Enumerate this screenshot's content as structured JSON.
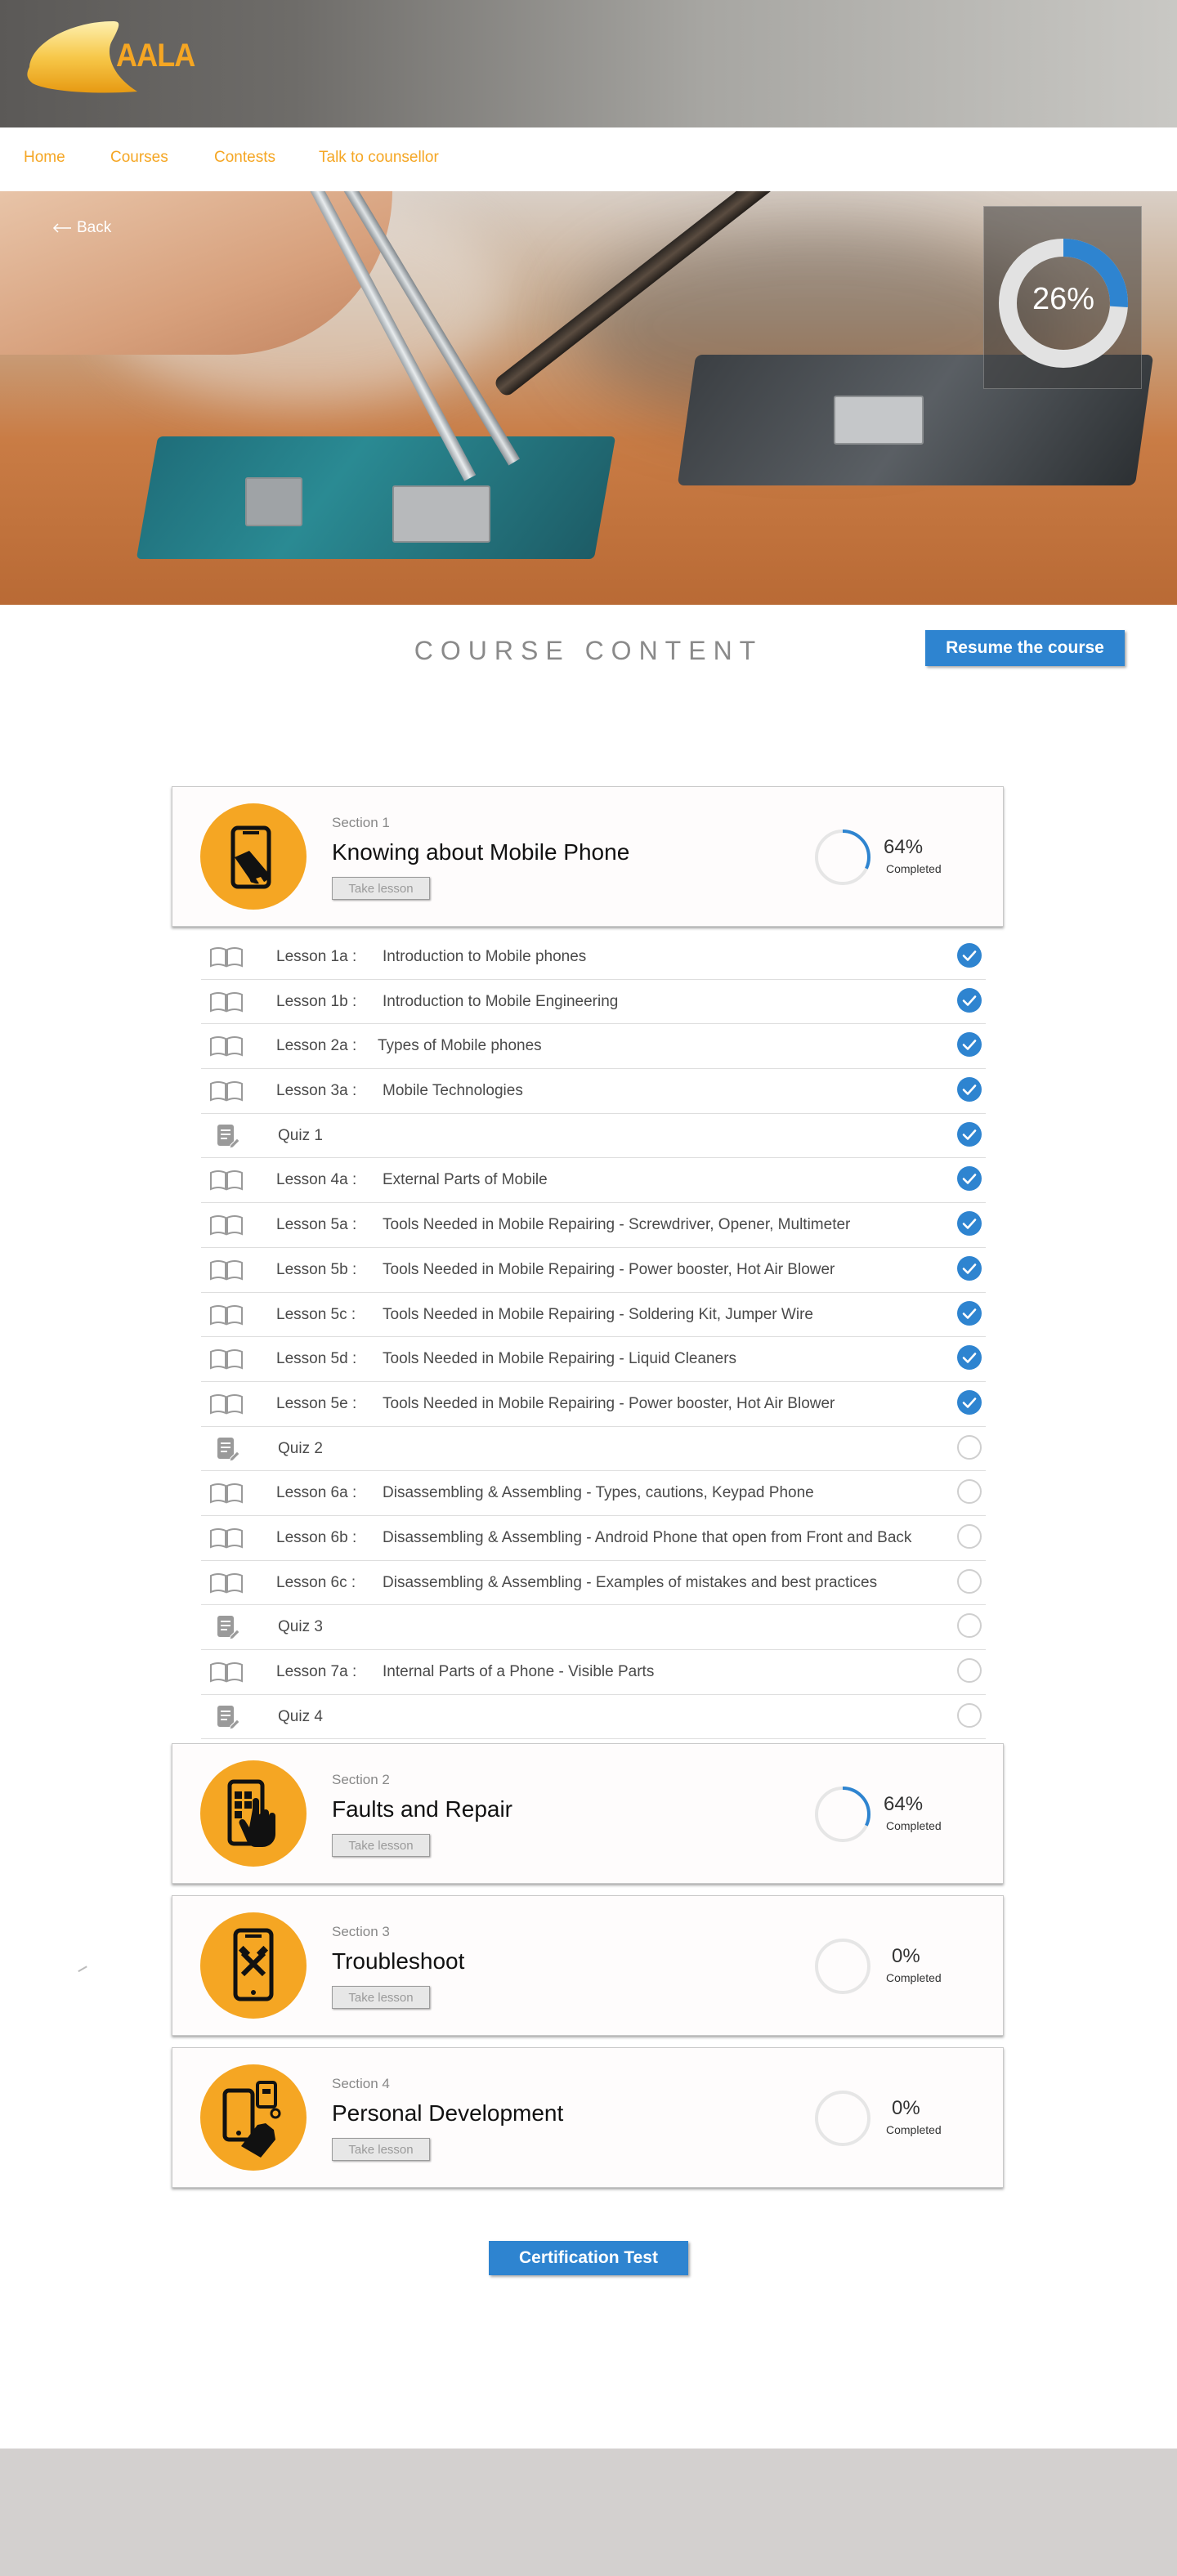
{
  "brand": {
    "name": "AALA",
    "accent": "#f5a623",
    "primary": "#2e84d0"
  },
  "nav": {
    "items": [
      {
        "label": "Home"
      },
      {
        "label": "Courses"
      },
      {
        "label": "Contests"
      },
      {
        "label": "Talk to counsellor"
      }
    ]
  },
  "hero": {
    "back_label": "Back",
    "course_progress": "26%",
    "course_progress_value": 0.26
  },
  "content": {
    "title": "COURSE CONTENT",
    "resume_label": "Resume the course",
    "certification_label": "Certification Test"
  },
  "sections": [
    {
      "kicker": "Section 1",
      "title": "Knowing about Mobile Phone",
      "button": "Take lesson",
      "progress": "64%",
      "progress_value": 0.64,
      "status": "Completed",
      "icon": "phone-wrench-icon"
    },
    {
      "kicker": "Section 2",
      "title": "Faults and Repair",
      "button": "Take lesson",
      "progress": "64%",
      "progress_value": 0.64,
      "status": "Completed",
      "icon": "phone-touch-icon"
    },
    {
      "kicker": "Section 3",
      "title": "Troubleshoot",
      "button": "Take lesson",
      "progress": "0%",
      "progress_value": 0,
      "status": "Completed",
      "icon": "phone-tools-icon"
    },
    {
      "kicker": "Section 4",
      "title": "Personal Development",
      "button": "Take lesson",
      "progress": "0%",
      "progress_value": 0,
      "status": "Completed",
      "icon": "phone-hand-icon"
    }
  ],
  "lessons": [
    {
      "type": "lesson",
      "label": "Lesson 1a :",
      "title": "Introduction to Mobile phones",
      "done": true
    },
    {
      "type": "lesson",
      "label": "Lesson 1b :",
      "title": "Introduction to Mobile Engineering",
      "done": true
    },
    {
      "type": "lesson",
      "label": "Lesson 2a :",
      "title": "Types of Mobile phones",
      "done": true
    },
    {
      "type": "lesson",
      "label": "Lesson 3a :",
      "title": "Mobile Technologies",
      "done": true
    },
    {
      "type": "quiz",
      "label": "Quiz 1",
      "title": "",
      "done": true
    },
    {
      "type": "lesson",
      "label": "Lesson 4a :",
      "title": "External Parts of Mobile",
      "done": true
    },
    {
      "type": "lesson",
      "label": "Lesson 5a :",
      "title": "Tools Needed in Mobile Repairing - Screwdriver, Opener, Multimeter",
      "done": true
    },
    {
      "type": "lesson",
      "label": "Lesson 5b :",
      "title": "Tools Needed in Mobile Repairing - Power booster, Hot Air Blower",
      "done": true
    },
    {
      "type": "lesson",
      "label": "Lesson 5c :",
      "title": "Tools Needed in Mobile Repairing - Soldering Kit, Jumper Wire",
      "done": true
    },
    {
      "type": "lesson",
      "label": "Lesson 5d :",
      "title": "Tools Needed in Mobile Repairing - Liquid Cleaners",
      "done": true
    },
    {
      "type": "lesson",
      "label": "Lesson 5e :",
      "title": "Tools Needed in Mobile Repairing - Power booster, Hot Air Blower",
      "done": true
    },
    {
      "type": "quiz",
      "label": "Quiz 2",
      "title": "",
      "done": false
    },
    {
      "type": "lesson",
      "label": "Lesson 6a :",
      "title": "Disassembling & Assembling - Types, cautions, Keypad Phone",
      "done": false
    },
    {
      "type": "lesson",
      "label": "Lesson 6b :",
      "title": "Disassembling & Assembling - Android Phone that open from Front and Back",
      "done": false
    },
    {
      "type": "lesson",
      "label": "Lesson 6c :",
      "title": "Disassembling & Assembling - Examples of mistakes and best practices",
      "done": false
    },
    {
      "type": "quiz",
      "label": "Quiz 3",
      "title": "",
      "done": false
    },
    {
      "type": "lesson",
      "label": "Lesson 7a :",
      "title": "Internal Parts of a Phone - Visible Parts",
      "done": false
    },
    {
      "type": "quiz",
      "label": "Quiz 4",
      "title": "",
      "done": false
    }
  ]
}
